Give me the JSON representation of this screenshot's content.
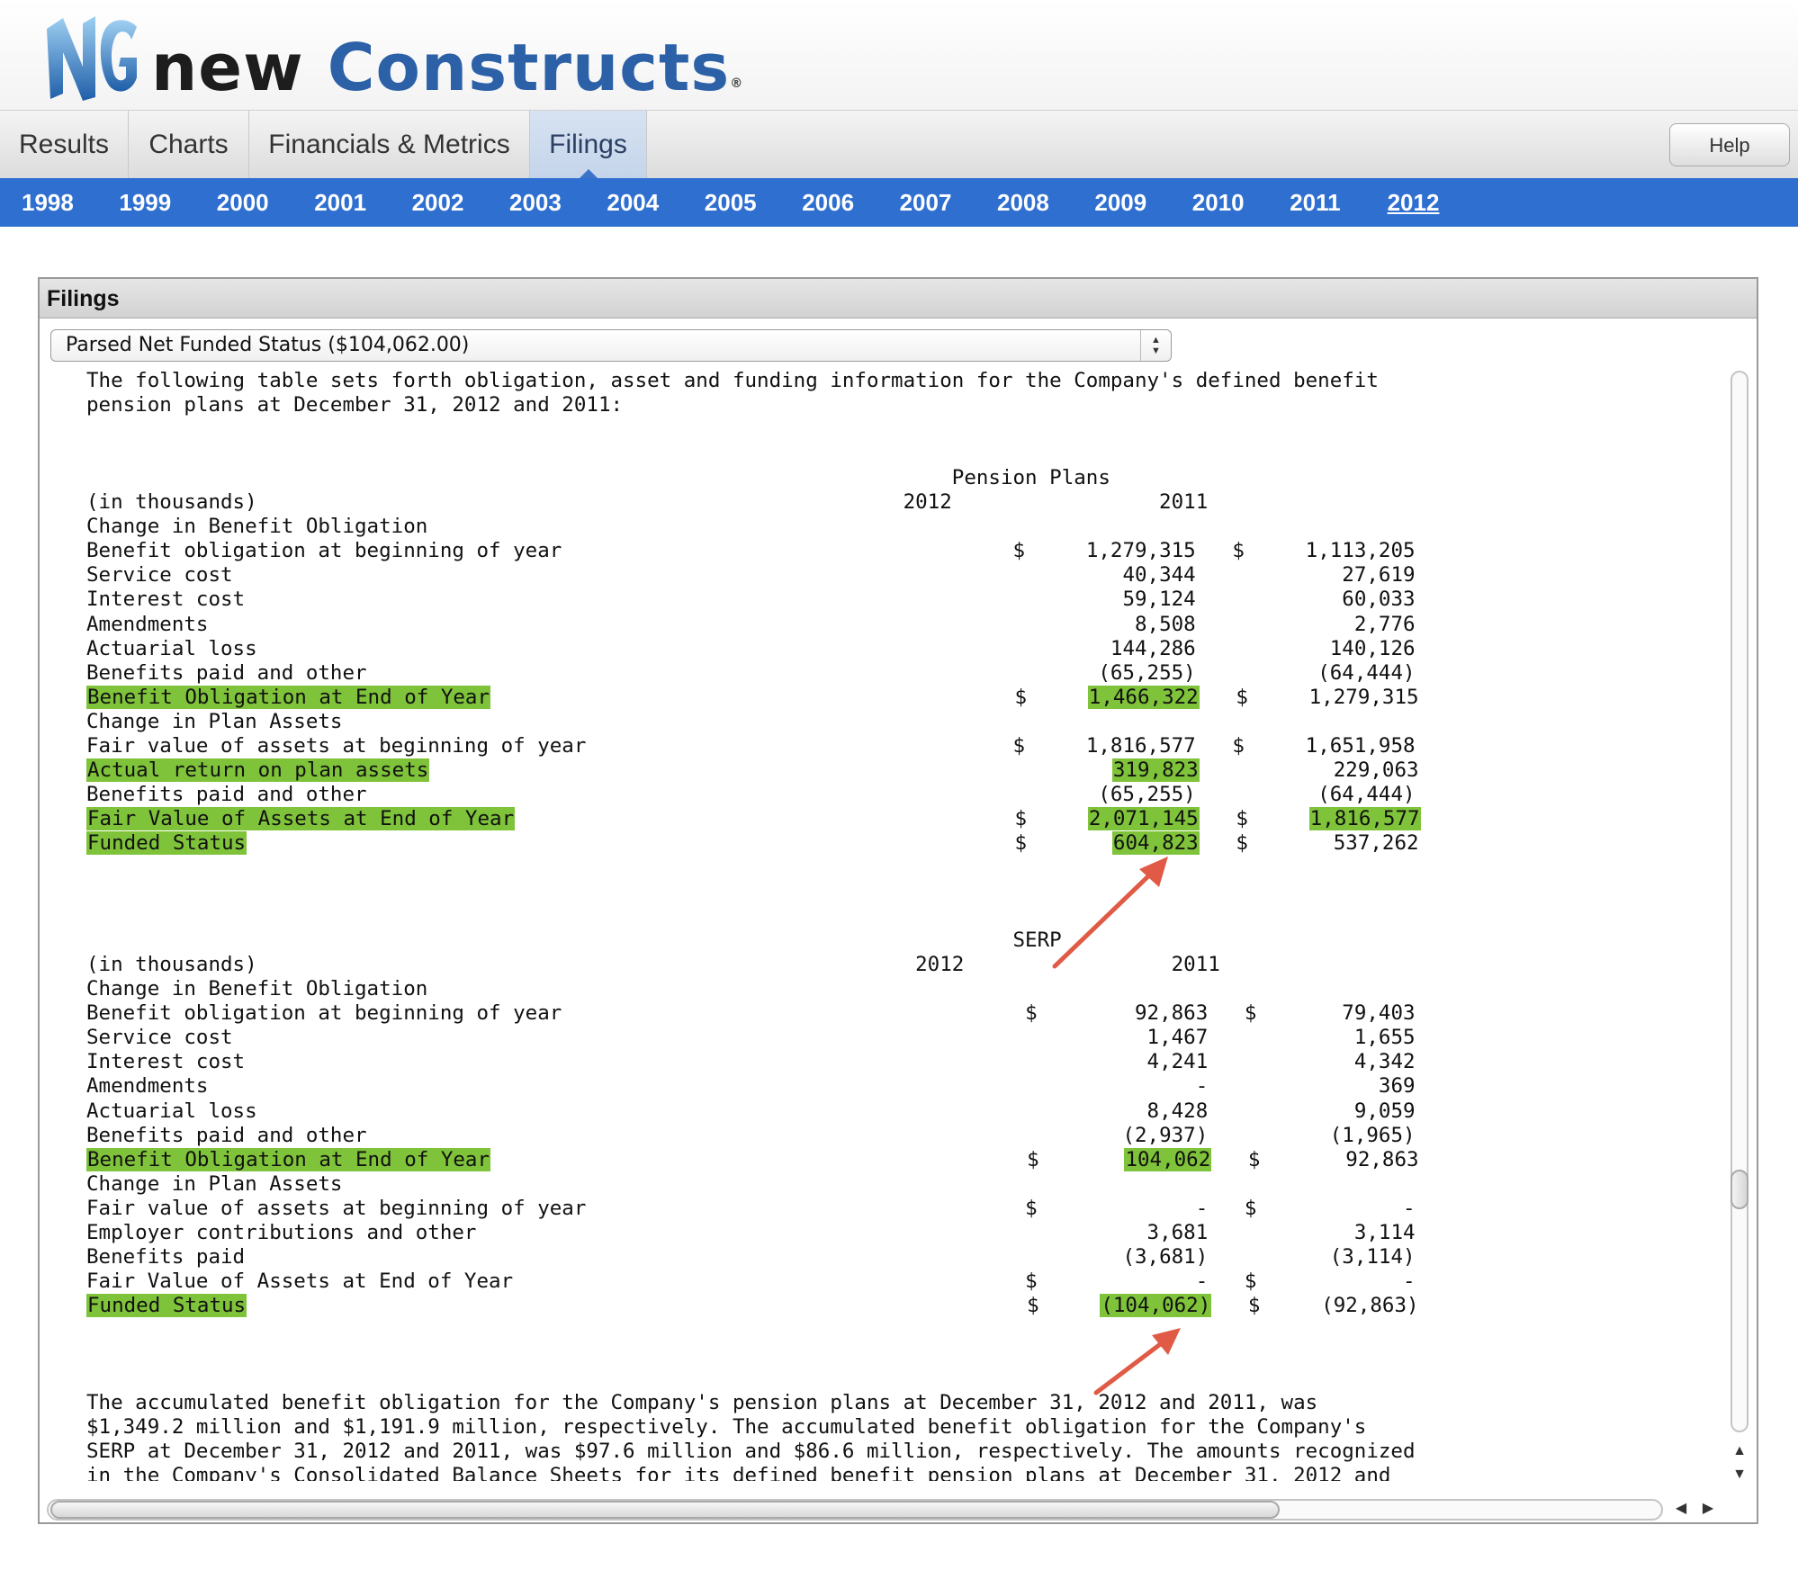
{
  "brand": {
    "word1": "new",
    "word2": "Constructs",
    "registered": "®",
    "logo_icon": "nc-logo-icon"
  },
  "tabs": [
    {
      "label": "Results"
    },
    {
      "label": "Charts"
    },
    {
      "label": "Financials & Metrics"
    },
    {
      "label": "Filings",
      "active": true
    }
  ],
  "help_label": "Help",
  "years": [
    "1998",
    "1999",
    "2000",
    "2001",
    "2002",
    "2003",
    "2004",
    "2005",
    "2006",
    "2007",
    "2008",
    "2009",
    "2010",
    "2011",
    "2012"
  ],
  "selected_year": "2012",
  "panel": {
    "title": "Filings",
    "select_value": "Parsed Net Funded Status ($104,062.00)"
  },
  "doc_lines": [
    {
      "text": "The following table sets forth obligation, asset and funding information for the Company's defined benefit"
    },
    {
      "text": "pension plans at December 31, 2012 and 2011:"
    },
    {
      "text": ""
    },
    {
      "text": ""
    },
    {
      "text": "                                                                       Pension Plans"
    },
    {
      "text": "(in thousands)                                                     2012                 2011"
    },
    {
      "text": "Change in Benefit Obligation"
    },
    {
      "label": "Benefit obligation at beginning of year",
      "d1": "$",
      "v1": "1,279,315",
      "d2": "$",
      "v2": "1,113,205"
    },
    {
      "label": "Service cost",
      "v1": "40,344",
      "v2": "27,619"
    },
    {
      "label": "Interest cost",
      "v1": "59,124",
      "v2": "60,033"
    },
    {
      "label": "Amendments",
      "v1": "8,508",
      "v2": "2,776"
    },
    {
      "label": "Actuarial loss",
      "v1": "144,286",
      "v2": "140,126"
    },
    {
      "label": "Benefits paid and other",
      "v1": "(65,255)",
      "v2": "(64,444)"
    },
    {
      "label": "Benefit Obligation at End of Year",
      "d1": "$",
      "v1": "1,466,322",
      "d2": "$",
      "v2": "1,279,315",
      "hl_label": true,
      "hl_v1": true
    },
    {
      "text": "Change in Plan Assets"
    },
    {
      "label": "Fair value of assets at beginning of year",
      "d1": "$",
      "v1": "1,816,577",
      "d2": "$",
      "v2": "1,651,958"
    },
    {
      "label": "Actual return on plan assets",
      "v1": "319,823",
      "v2": "229,063",
      "hl_label": true,
      "hl_v1": true
    },
    {
      "label": "Benefits paid and other",
      "v1": "(65,255)",
      "v2": "(64,444)"
    },
    {
      "label": "Fair Value of Assets at End of Year",
      "d1": "$",
      "v1": "2,071,145",
      "d2": "$",
      "v2": "1,816,577",
      "hl_label": true,
      "hl_v1": true,
      "hl_v2": true
    },
    {
      "label": "Funded Status",
      "d1": "$",
      "v1": "604,823",
      "d2": "$",
      "v2": "537,262",
      "hl_label": true,
      "hl_v1": true
    },
    {
      "text": ""
    },
    {
      "text": ""
    },
    {
      "text": ""
    },
    {
      "text": "                                                                            SERP"
    },
    {
      "text": "(in thousands)                                                      2012                 2011"
    },
    {
      "text": "Change in Benefit Obligation"
    },
    {
      "label": "Benefit obligation at beginning of year",
      "d1": "$",
      "v1": "92,863",
      "d2": "$",
      "v2": "79,403",
      "sw": 1
    },
    {
      "label": "Service cost",
      "v1": "1,467",
      "v2": "1,655",
      "sw": 1
    },
    {
      "label": "Interest cost",
      "v1": "4,241",
      "v2": "4,342",
      "sw": 1
    },
    {
      "label": "Amendments",
      "v1": "-",
      "v2": "369",
      "sw": 1
    },
    {
      "label": "Actuarial loss",
      "v1": "8,428",
      "v2": "9,059",
      "sw": 1
    },
    {
      "label": "Benefits paid and other",
      "v1": "(2,937)",
      "v2": "(1,965)",
      "sw": 1
    },
    {
      "label": "Benefit Obligation at End of Year",
      "d1": "$",
      "v1": "104,062",
      "d2": "$",
      "v2": "92,863",
      "hl_label": true,
      "hl_v1": true,
      "sw": 1
    },
    {
      "text": "Change in Plan Assets"
    },
    {
      "label": "Fair value of assets at beginning of year",
      "d1": "$",
      "v1": "-",
      "d2": "$",
      "v2": "-",
      "sw": 1
    },
    {
      "label": "Employer contributions and other",
      "v1": "3,681",
      "v2": "3,114",
      "sw": 1
    },
    {
      "label": "Benefits paid",
      "v1": "(3,681)",
      "v2": "(3,114)",
      "sw": 1
    },
    {
      "label": "Fair Value of Assets at End of Year",
      "d1": "$",
      "v1": "-",
      "d2": "$",
      "v2": "-",
      "sw": 1
    },
    {
      "label": "Funded Status",
      "d1": "$",
      "v1": "(104,062)",
      "d2": "$",
      "v2": "(92,863)",
      "hl_label": true,
      "hl_v1": true,
      "sw": 1
    },
    {
      "text": ""
    },
    {
      "text": ""
    },
    {
      "text": ""
    },
    {
      "text": "The accumulated benefit obligation for the Company's pension plans at December 31, 2012 and 2011, was"
    },
    {
      "text": "$1,349.2 million and $1,191.9 million, respectively. The accumulated benefit obligation for the Company's"
    },
    {
      "text": "SERP at December 31, 2012 and 2011, was $97.6 million and $86.6 million, respectively. The amounts recognized"
    },
    {
      "text": "in the Company's Consolidated Balance Sheets for its defined benefit pension plans at December 31, 2012 and"
    }
  ],
  "colors": {
    "highlight": "#7fc33a",
    "year_bar": "#2f6fd0",
    "arrow": "#e05a45",
    "brand_blue": "#2c61a8"
  }
}
